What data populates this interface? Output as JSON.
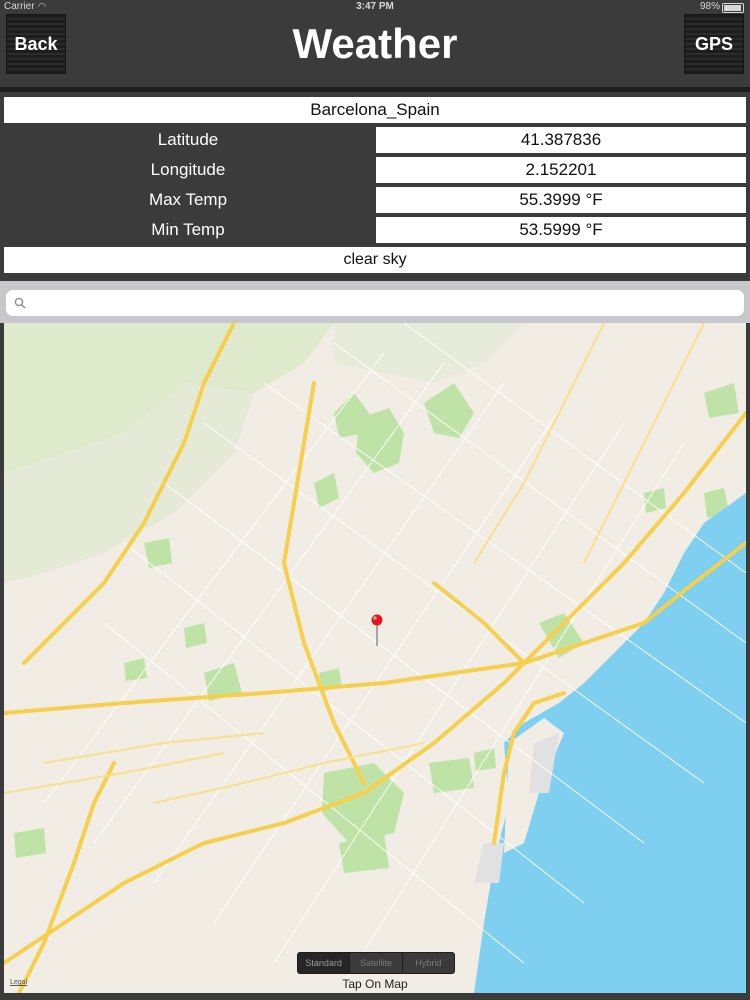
{
  "status_bar": {
    "carrier": "Carrier",
    "time": "3:47 PM",
    "battery": "98%"
  },
  "nav": {
    "back_label": "Back",
    "title": "Weather",
    "gps_label": "GPS"
  },
  "weather": {
    "city": "Barcelona_Spain",
    "rows": [
      {
        "label": "Latitude",
        "value": "41.387836"
      },
      {
        "label": "Longitude",
        "value": "2.152201"
      },
      {
        "label": "Max Temp",
        "value": "55.3999 °F"
      },
      {
        "label": "Min Temp",
        "value": "53.5999 °F"
      }
    ],
    "description": "clear sky"
  },
  "search": {
    "placeholder": ""
  },
  "map": {
    "map_types": [
      "Standard",
      "Satellite",
      "Hybrid"
    ],
    "selected_map_type": "Standard",
    "hint": "Tap On Map",
    "legal": "Legal",
    "colors": {
      "land": "#f1ede4",
      "park": "#bfe3a6",
      "water": "#7fcff0",
      "road_major": "#f6cf4d",
      "pin": "#e0161e"
    }
  }
}
